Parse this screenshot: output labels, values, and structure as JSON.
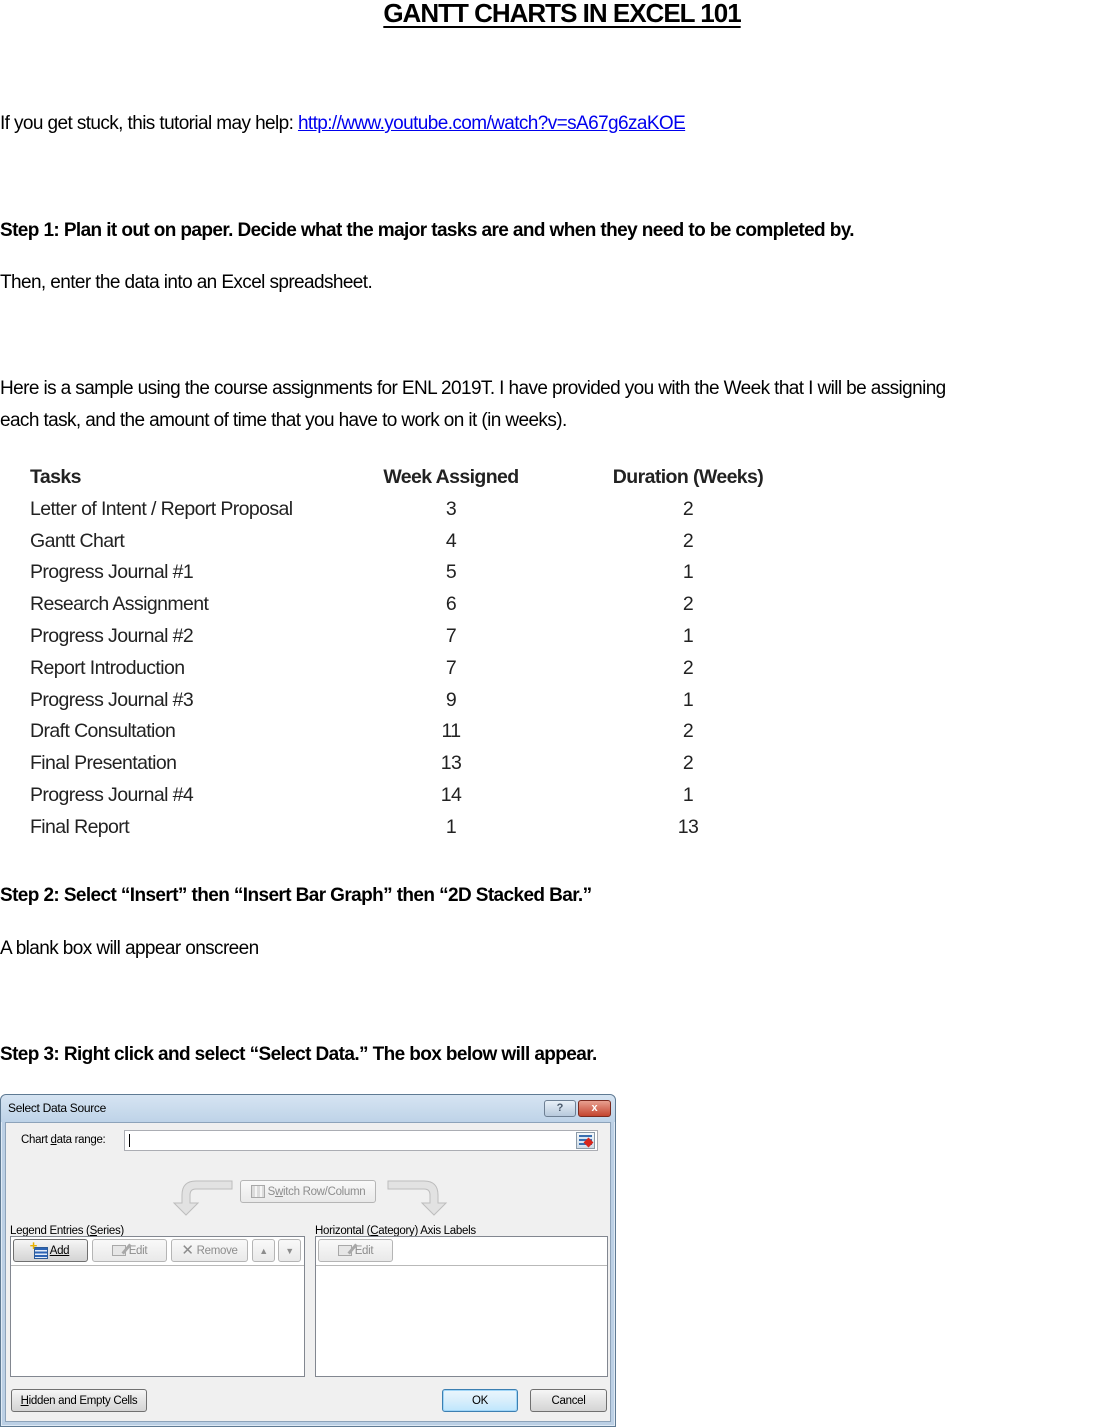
{
  "document": {
    "title": "GANTT CHARTS IN EXCEL 101",
    "intro_prefix": "If you get stuck, this tutorial may help: ",
    "intro_link": "http://www.youtube.com/watch?v=sA67g6zaKOE",
    "step1_heading": "Step 1: Plan it out on paper. Decide what the major tasks are and when they need to be completed by.",
    "step1_text": "Then, enter the data into an Excel spreadsheet.",
    "sample_line1": "Here is a sample using the course assignments for ENL 2019T.  I have provided you with the Week that I will be assigning",
    "sample_line2": "each task, and the amount of time that you have to work on it (in weeks).",
    "step2_heading": "Step 2: Select  “Insert” then  “Insert Bar Graph” then “2D Stacked Bar.”",
    "step2_text": "A blank box will appear onscreen",
    "step3_heading": "Step 3: Right click and select “Select Data.” The box below will appear."
  },
  "table": {
    "headers": [
      "Tasks",
      "Week Assigned",
      "Duration (Weeks)"
    ],
    "rows": [
      [
        "Letter of Intent / Report Proposal",
        "3",
        "2"
      ],
      [
        "Gantt Chart",
        "4",
        "2"
      ],
      [
        "Progress Journal #1",
        "5",
        "1"
      ],
      [
        "Research Assignment",
        "6",
        "2"
      ],
      [
        "Progress Journal #2",
        "7",
        "1"
      ],
      [
        "Report Introduction",
        "7",
        "2"
      ],
      [
        "Progress Journal #3",
        "9",
        "1"
      ],
      [
        "Draft Consultation",
        "11",
        "2"
      ],
      [
        "Final Presentation",
        "13",
        "2"
      ],
      [
        "Progress Journal #4",
        "14",
        "1"
      ],
      [
        "Final Report",
        "1",
        "13"
      ]
    ]
  },
  "dialog": {
    "title": "Select Data Source",
    "help_icon": "?",
    "close_icon": "x",
    "chart_range_label_pre": "Chart ",
    "chart_range_label_u": "d",
    "chart_range_label_post": "ata range:",
    "chart_range_value": "",
    "switch_label_pre": "S",
    "switch_label_u": "w",
    "switch_label_post": "itch Row/Column",
    "legend_label_pre": "Legend Entries (",
    "legend_label_u": "S",
    "legend_label_post": "eries)",
    "axis_label_pre": "Horizontal (",
    "axis_label_u": "C",
    "axis_label_post": "ategory) Axis Labels",
    "add_label": "Add",
    "edit_label": "Edit",
    "remove_label": "Remove",
    "axis_edit_label": "Edit",
    "hidden_cells_label_u": "H",
    "hidden_cells_label_post": "idden and Empty Cells",
    "ok_label": "OK",
    "cancel_label": "Cancel"
  }
}
